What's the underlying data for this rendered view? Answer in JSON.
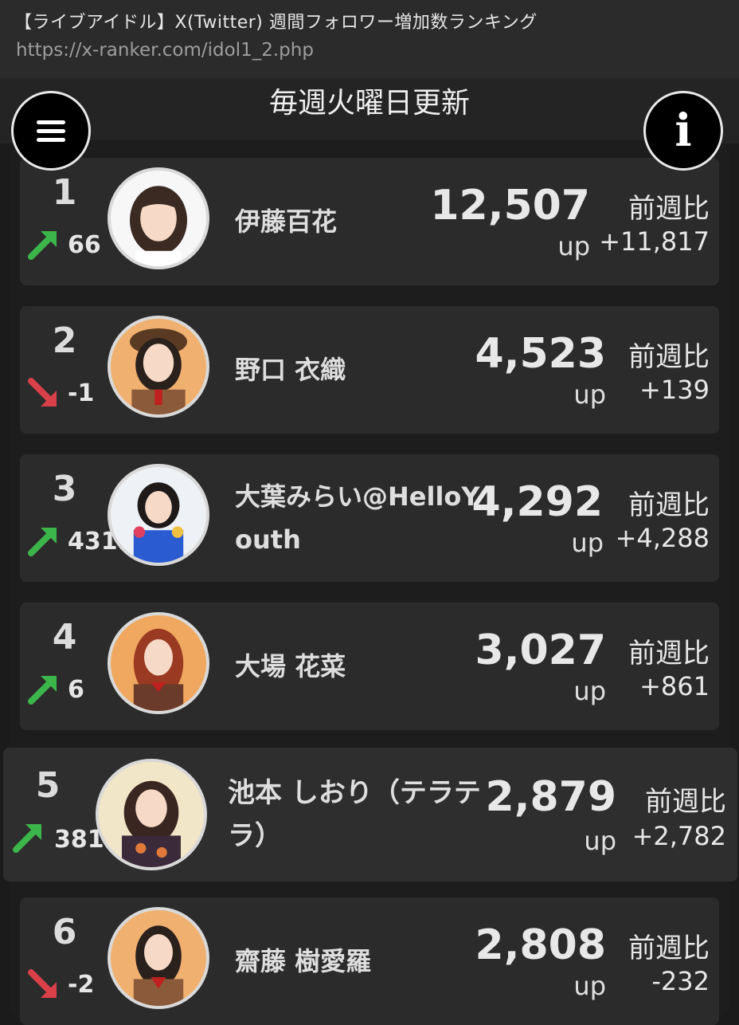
{
  "browser": {
    "title": "【ライブアイドル】X(Twitter) 週間フォロワー増加数ランキング",
    "url": "https://x-ranker.com/idol1_2.php"
  },
  "header": {
    "update_text": "毎週火曜日更新",
    "menu_icon": "hamburger-menu-icon",
    "info_icon": "info-icon",
    "info_glyph": "i"
  },
  "labels": {
    "prev_week": "前週比",
    "up": "up"
  },
  "colors": {
    "up_arrow": "#3cb54a",
    "down_arrow": "#d9404a",
    "row_bg": "#2b2b2b",
    "page_bg": "#1b1b1b"
  },
  "rankings": [
    {
      "rank": "1",
      "trend": "up",
      "change": "66",
      "name": "伊藤百花",
      "count": "12,507",
      "diff": "+11,817"
    },
    {
      "rank": "2",
      "trend": "down",
      "change": "-1",
      "name": "野口 衣織",
      "count": "4,523",
      "diff": "+139"
    },
    {
      "rank": "3",
      "trend": "up",
      "change": "4319",
      "name": "大葉みらい@HelloYouth",
      "count": "4,292",
      "diff": "+4,288"
    },
    {
      "rank": "4",
      "trend": "up",
      "change": "6",
      "name": "大場 花菜",
      "count": "3,027",
      "diff": "+861"
    },
    {
      "rank": "5",
      "trend": "up",
      "change": "381",
      "name": "池本 しおり（テラテラ）",
      "count": "2,879",
      "diff": "+2,782"
    },
    {
      "rank": "6",
      "trend": "down",
      "change": "-2",
      "name": "齋藤 樹愛羅",
      "count": "2,808",
      "diff": "-232"
    }
  ]
}
